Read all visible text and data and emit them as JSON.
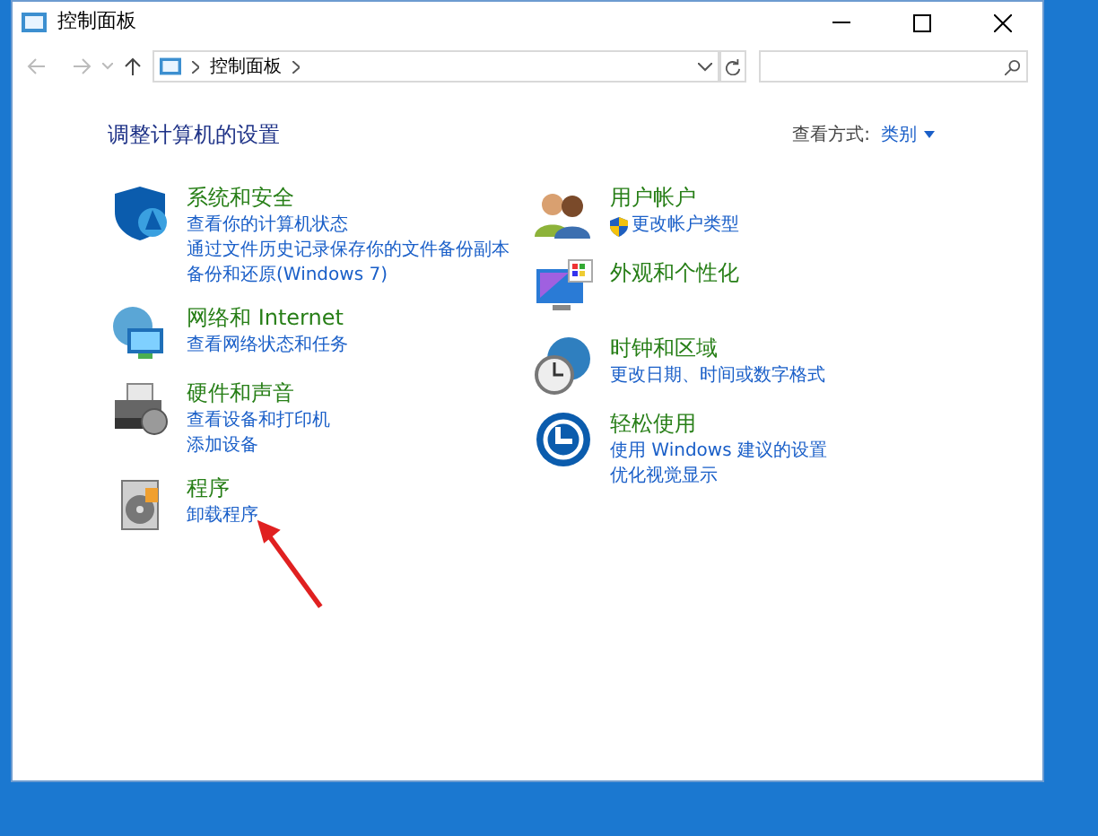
{
  "window": {
    "title": "控制面板"
  },
  "address_bar": {
    "path": "控制面板"
  },
  "heading": "调整计算机的设置",
  "view_by": {
    "label": "查看方式:",
    "value": "类别"
  },
  "columns": [
    [
      {
        "kind": "security",
        "title": "系统和安全",
        "links": [
          "查看你的计算机状态",
          "通过文件历史记录保存你的文件备份副本",
          "备份和还原(Windows 7)"
        ]
      },
      {
        "kind": "network",
        "title": "网络和 Internet",
        "links": [
          "查看网络状态和任务"
        ]
      },
      {
        "kind": "hardware",
        "title": "硬件和声音",
        "links": [
          "查看设备和打印机",
          "添加设备"
        ]
      },
      {
        "kind": "programs",
        "title": "程序",
        "links": [
          "卸载程序"
        ]
      }
    ],
    [
      {
        "kind": "users",
        "title": "用户帐户",
        "links": [
          "更改帐户类型"
        ],
        "shield_link": true
      },
      {
        "kind": "appearance",
        "title": "外观和个性化"
      },
      {
        "kind": "clock",
        "title": "时钟和区域",
        "links": [
          "更改日期、时间或数字格式"
        ]
      },
      {
        "kind": "ease",
        "title": "轻松使用",
        "links": [
          "使用 Windows 建议的设置",
          "优化视觉显示"
        ]
      }
    ]
  ]
}
